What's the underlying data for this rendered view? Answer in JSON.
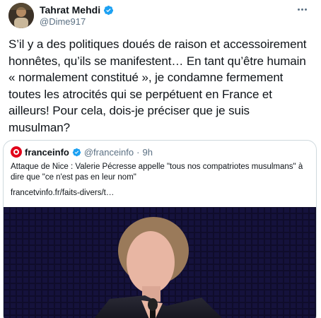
{
  "tweet": {
    "author": {
      "display_name": "Tahrat Mehdi",
      "handle": "@Dime917",
      "verified": true,
      "avatar_icon": "user-avatar"
    },
    "more_icon": "more-options-icon",
    "text": "S’il y a des politiques doués de raison et accessoirement honnêtes, qu’ils se manifestent… En tant qu’être humain « normalement constitué », je condamne fermement toutes les atrocités qui se perpétuent en France et ailleurs! Pour cela, dois-je préciser que je suis musulman?"
  },
  "quoted": {
    "author": {
      "display_name": "franceinfo",
      "handle": "@franceinfo",
      "separator": "·",
      "time": "9h",
      "verified": true,
      "brand_color": "#e2001a"
    },
    "text": "Attaque de Nice : Valerie Pécresse appelle \"tous nos compatriotes musulmans\" à dire que \"ce n'est pas en leur nom\"",
    "link": "francetvinfo.fr/faits-divers/t…",
    "image_description_icon": "news-photo"
  },
  "colors": {
    "verified_badge": "#1da1f2",
    "secondary_text": "#5b7083",
    "border": "#cfd9de"
  }
}
